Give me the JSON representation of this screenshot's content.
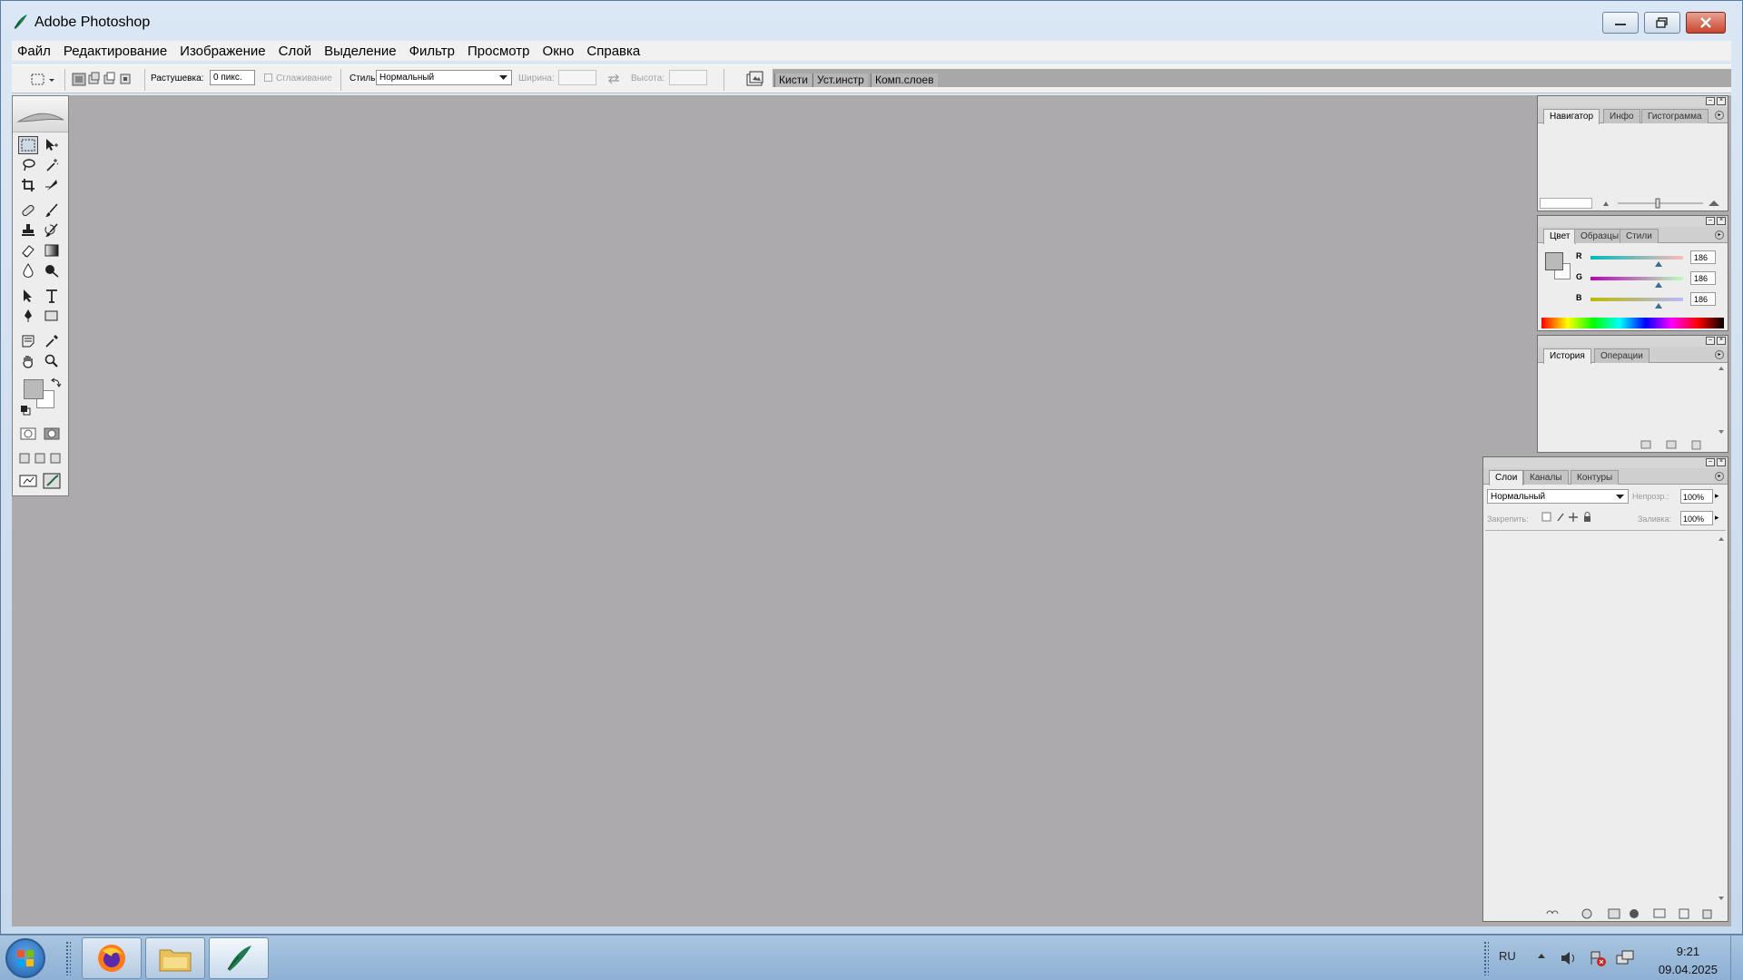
{
  "window": {
    "title": "Adobe Photoshop"
  },
  "menu": [
    "Файл",
    "Редактирование",
    "Изображение",
    "Слой",
    "Выделение",
    "Фильтр",
    "Просмотр",
    "Окно",
    "Справка"
  ],
  "options": {
    "feather_label": "Растушевка:",
    "feather_value": "0 пикс.",
    "antialias_label": "Сглаживание",
    "style_label": "Стиль:",
    "style_value": "Нормальный",
    "width_label": "Ширина:",
    "height_label": "Высота:"
  },
  "palette_well": {
    "tabs": [
      "Кисти",
      "Уст.инстр",
      "Комп.слоев"
    ]
  },
  "navigator": {
    "tabs": [
      "Навигатор",
      "Инфо",
      "Гистограмма"
    ]
  },
  "color": {
    "tabs": [
      "Цвет",
      "Образцы",
      "Стили"
    ],
    "channels": [
      {
        "label": "R",
        "value": "186"
      },
      {
        "label": "G",
        "value": "186"
      },
      {
        "label": "B",
        "value": "186"
      }
    ],
    "foreground": "#bababa"
  },
  "history": {
    "tabs": [
      "История",
      "Операции"
    ]
  },
  "layers": {
    "tabs": [
      "Слои",
      "Каналы",
      "Контуры"
    ],
    "blend_mode": "Нормальный",
    "opacity_label": "Непрозр.:",
    "opacity_value": "100%",
    "lock_label": "Закрепить:",
    "fill_label": "Заливка:",
    "fill_value": "100%"
  },
  "taskbar": {
    "language": "RU",
    "time": "9:21",
    "date": "09.04.2025"
  }
}
